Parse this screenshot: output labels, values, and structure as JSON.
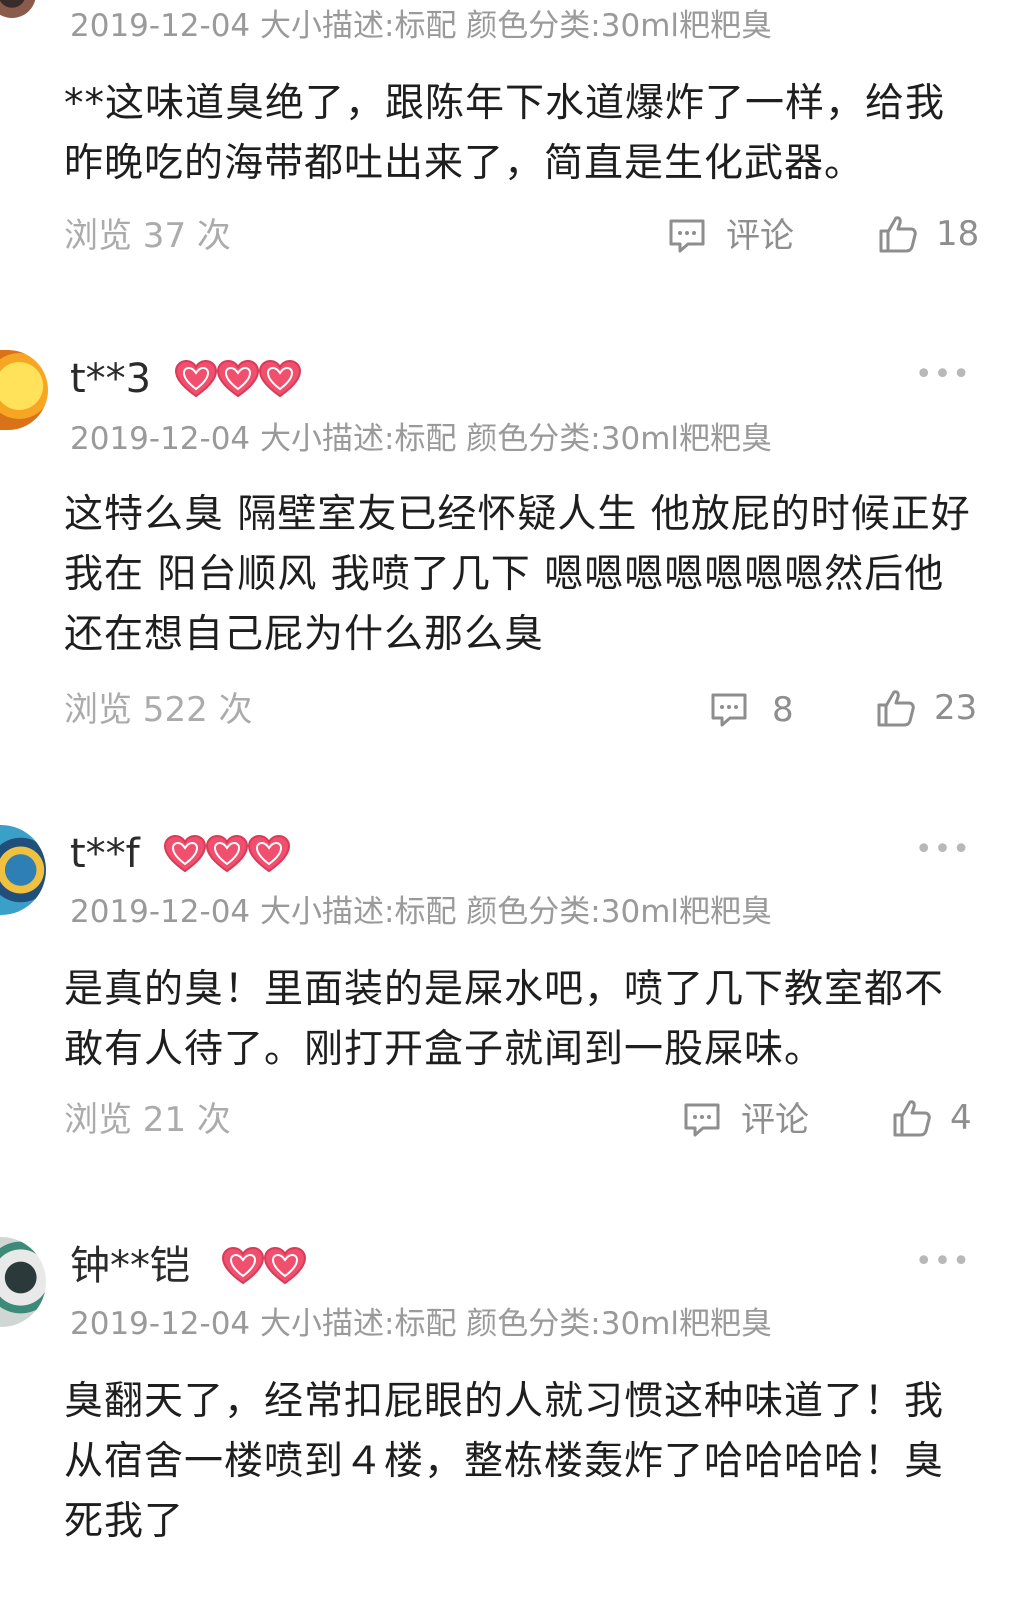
{
  "reviews": [
    {
      "username": "",
      "meta": "2019-12-04 大小描述:标配 颜色分类:30ml粑粑臭",
      "content": "**这味道臭绝了，跟陈年下水道爆炸了一样，给我昨晚吃的海带都吐出来了，简直是生化武器。",
      "views": "浏览 37 次",
      "comments": "评论",
      "likes": "18"
    },
    {
      "username": "t**3",
      "meta": "2019-12-04 大小描述:标配 颜色分类:30ml粑粑臭",
      "content": "这特么臭 隔壁室友已经怀疑人生 他放屁的时候正好我在 阳台顺风  我喷了几下  嗯嗯嗯嗯嗯嗯嗯然后他还在想自己屁为什么那么臭",
      "views": "浏览 522 次",
      "comments": "8",
      "likes": "23"
    },
    {
      "username": "t**f",
      "meta": "2019-12-04 大小描述:标配 颜色分类:30ml粑粑臭",
      "content": "是真的臭！里面装的是屎水吧，喷了几下教室都不敢有人待了。刚打开盒子就闻到一股屎味。",
      "views": "浏览 21 次",
      "comments": "评论",
      "likes": "4"
    },
    {
      "username": "钟**铠",
      "meta": "2019-12-04 大小描述:标配 颜色分类:30ml粑粑臭",
      "content": "臭翻天了，经常扣屁眼的人就习惯这种味道了！我从宿舍一楼喷到４楼，整栋楼轰炸了哈哈哈哈！臭死我了"
    }
  ],
  "icons": {
    "heart": "heart-badge-icon",
    "comment": "comment-bubble-icon",
    "like": "thumbs-up-icon",
    "more": "more-dots-icon"
  },
  "colors": {
    "heart": "#f0506e",
    "meta_text": "#9a9a9a",
    "icon_gray": "#8e8e8e"
  }
}
